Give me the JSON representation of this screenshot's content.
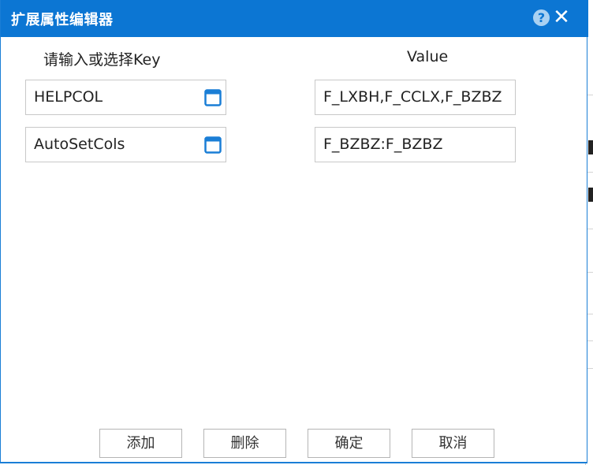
{
  "dialog": {
    "title": "扩展属性编辑器",
    "help_icon": "question-circle-icon",
    "close_icon": "close-x-icon",
    "help_glyph": "?",
    "close_glyph": "✕"
  },
  "headers": {
    "key": "请输入或选择Key",
    "value": "Value"
  },
  "rows": [
    {
      "key": "HELPCOL",
      "value": "F_LXBH,F_CCLX,F_BZBZ"
    },
    {
      "key": "AutoSetCols",
      "value": "F_BZBZ:F_BZBZ"
    }
  ],
  "buttons": {
    "add": "添加",
    "delete": "删除",
    "confirm": "确定",
    "cancel": "取消"
  },
  "colors": {
    "titlebar": "#0c76d3",
    "icon_blue": "#1a7ed6"
  }
}
